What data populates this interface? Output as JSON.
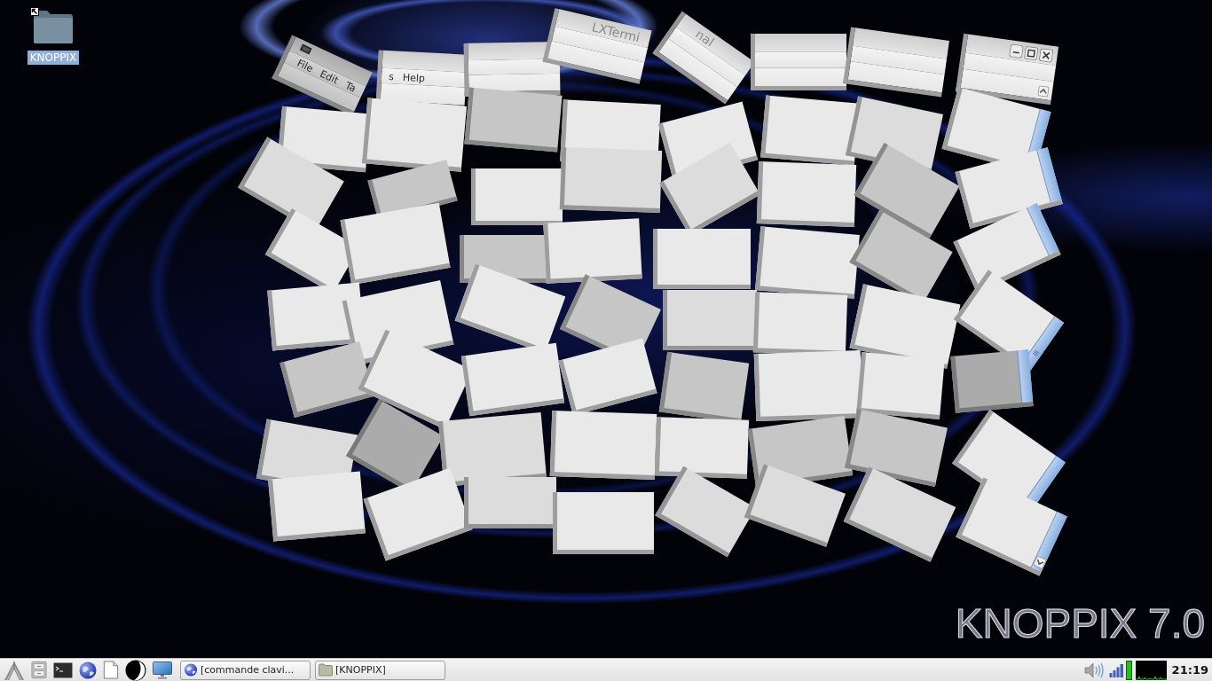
{
  "desktop": {
    "icons": [
      {
        "label": "KNOPPIX",
        "selected": true
      }
    ],
    "window_pieces": [
      {
        "menu_items": [
          "File",
          "Edit",
          "Ta"
        ]
      },
      {
        "menu_items": [
          "s",
          "Help"
        ]
      },
      {
        "title": "LXTermi"
      },
      {
        "title": "nal"
      }
    ],
    "wallpaper_text": "KNOPPIX 7.0"
  },
  "taskbar": {
    "tasks": [
      {
        "kind": "browser",
        "label": "[commande clavi..."
      },
      {
        "kind": "folder",
        "label": "[KNOPPIX]"
      }
    ],
    "clock": "21:19"
  }
}
